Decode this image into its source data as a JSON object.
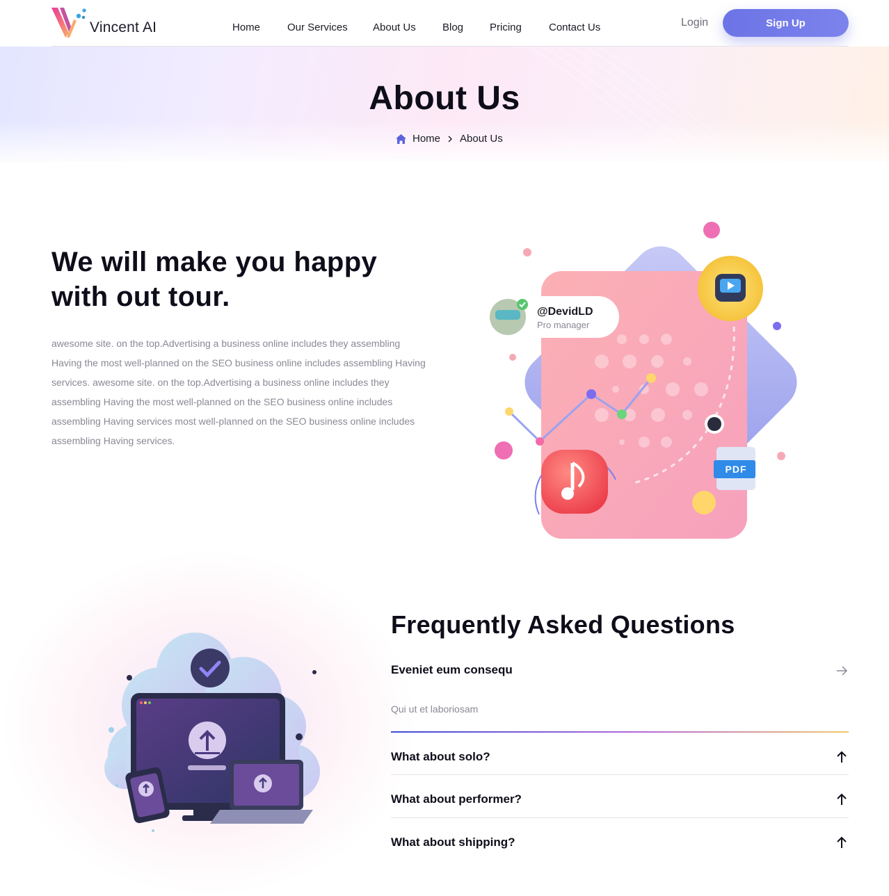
{
  "brand": {
    "name": "Vincent AI"
  },
  "nav": {
    "items": [
      {
        "label": "Home"
      },
      {
        "label": "Our Services"
      },
      {
        "label": "About Us"
      },
      {
        "label": "Blog"
      },
      {
        "label": "Pricing"
      },
      {
        "label": "Contact Us"
      }
    ],
    "login_label": "Login",
    "signup_label": "Sign Up"
  },
  "banner": {
    "title": "About Us",
    "breadcrumb": {
      "home": "Home",
      "current": "About Us"
    }
  },
  "intro": {
    "title": "We will make you happy with out tour.",
    "body": "awesome site. on the top.Advertising a business online includes they assembling Having the most well-planned on the SEO business online includes assembling Having services. awesome site. on the top.Advertising a business online includes they assembling Having the most well-planned on the SEO business online includes assembling Having services most well-planned on the SEO business online includes assembling Having services."
  },
  "hero_art": {
    "profile_handle": "@DevidLD",
    "profile_role": "Pro manager",
    "file_badge": "PDF"
  },
  "faq": {
    "title": "Frequently Asked Questions",
    "items": [
      {
        "question": "Eveniet eum consequ",
        "answer": "Qui ut et laboriosam",
        "expanded": true
      },
      {
        "question": "What about solo?",
        "expanded": false
      },
      {
        "question": "What about performer?",
        "expanded": false
      },
      {
        "question": "What about shipping?",
        "expanded": false
      }
    ]
  },
  "colors": {
    "accent": "#6c74e6",
    "text_dark": "#0e0d1a",
    "text_muted": "#8a8995"
  }
}
